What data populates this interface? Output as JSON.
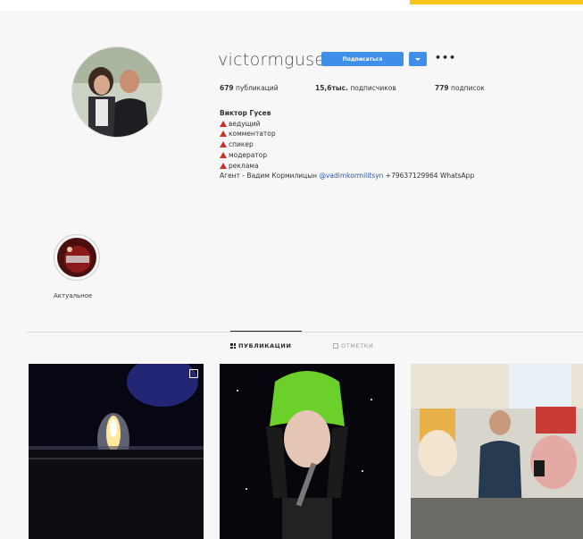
{
  "profile": {
    "username": "victormgusev",
    "follow_label": "Подписаться",
    "more_label": "•••",
    "stats": {
      "posts_value": "679",
      "posts_label": "публикаций",
      "followers_value": "15,6тыс.",
      "followers_label": "подписчиков",
      "following_value": "779",
      "following_label": "подписок"
    },
    "bio": {
      "name": "Виктор Гусев",
      "roles": [
        "ведущий",
        "комментатор",
        "спикер",
        "модератор",
        "реклама"
      ],
      "agent_prefix": "Агент - Вадим Кормилицын",
      "agent_handle": "@vadimkormilitsyn",
      "agent_suffix": "+79637129964 WhatsApp"
    }
  },
  "highlight": {
    "label": "Актуальное"
  },
  "tabs": {
    "posts": "ПУБЛИКАЦИИ",
    "tagged": "ОТМЕТКИ"
  },
  "colors": {
    "accent": "#3f8ee8",
    "warning_triangle": "#c9302c",
    "brand_tab": "#f5c518"
  }
}
